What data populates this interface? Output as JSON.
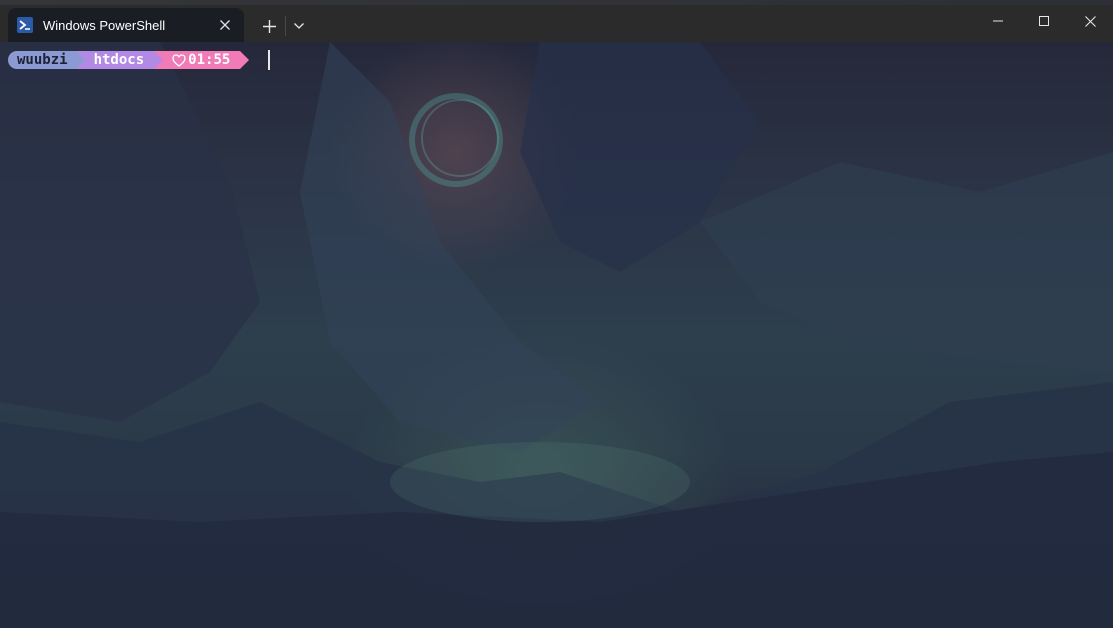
{
  "window": {
    "tab_title": "Windows PowerShell",
    "tab_icon": "powershell-icon",
    "close_tab_icon": "close-icon",
    "new_tab_icon": "plus-icon",
    "dropdown_icon": "chevron-down-icon",
    "minimize_icon": "minimize-icon",
    "maximize_icon": "maximize-icon",
    "close_window_icon": "close-icon"
  },
  "prompt": {
    "user": "wuubzi",
    "directory": "htdocs",
    "time_icon": "heart-icon",
    "time": "01:55"
  },
  "colors": {
    "user_segment": "#8c9ad4",
    "dir_segment": "#b28ae6",
    "time_segment": "#f17bb6",
    "titlebar": "#2b2b2b",
    "active_tab": "#1b1d24"
  }
}
